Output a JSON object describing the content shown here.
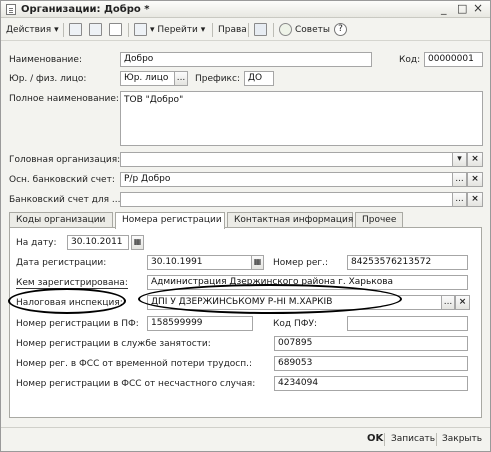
{
  "window": {
    "title": "Организации: Добро *",
    "min_glyph": "_",
    "max_glyph": "□",
    "close_glyph": "×"
  },
  "toolbar": {
    "actions_label": "Действия",
    "goto_label": "Перейти",
    "rights_label": "Права",
    "tips_label": "Советы",
    "help_glyph": "?"
  },
  "form": {
    "name_label": "Наименование:",
    "name_value": "Добро",
    "code_label": "Код:",
    "code_value": "00000001",
    "legal_type_label": "Юр. / физ. лицо:",
    "legal_type_value": "Юр. лицо",
    "prefix_label": "Префикс:",
    "prefix_value": "ДО",
    "full_name_label": "Полное наименование:",
    "full_name_value": "ТОВ \"Добро\"",
    "head_org_label": "Головная организация:",
    "head_org_value": "",
    "main_account_label": "Осн. банковский счет:",
    "main_account_value": "Р/р Добро",
    "bank_account_label": "Банковский счет для ...",
    "bank_account_value": ""
  },
  "tabs": [
    {
      "label": "Коды организации"
    },
    {
      "label": "Номера регистрации"
    },
    {
      "label": "Контактная информация"
    },
    {
      "label": "Прочее"
    }
  ],
  "registration": {
    "date_label": "На дату:",
    "date_value": "30.10.2011",
    "reg_date_label": "Дата регистрации:",
    "reg_date_value": "30.10.1991",
    "reg_number_label": "Номер рег.:",
    "reg_number_value": "84253576213572",
    "registered_by_label": "Кем зарегистрирована:",
    "registered_by_value": "Администрация Дзержинского района г. Харькова",
    "tax_label": "Налоговая инспекция:",
    "tax_value": "ДПІ У ДЗЕРЖИНСЬКОМУ Р-НІ М.ХАРКІВ",
    "pf_number_label": "Номер регистрации в ПФ:",
    "pf_number_value": "158599999",
    "pfu_code_label": "Код ПФУ:",
    "pfu_code_value": "",
    "employment_label": "Номер регистрации в службе занятости:",
    "employment_value": "007895",
    "fss_temp_label": "Номер рег. в ФСС от временной потери трудосп.:",
    "fss_temp_value": "689053",
    "fss_accident_label": "Номер регистрации в ФСС от несчастного случая:",
    "fss_accident_value": "4234094"
  },
  "footer": {
    "ok_label": "OK",
    "save_label": "Записать",
    "close_label": "Закрыть"
  },
  "glyphs": {
    "ellipsis": "...",
    "clear": "×",
    "dropdown": "▾"
  }
}
